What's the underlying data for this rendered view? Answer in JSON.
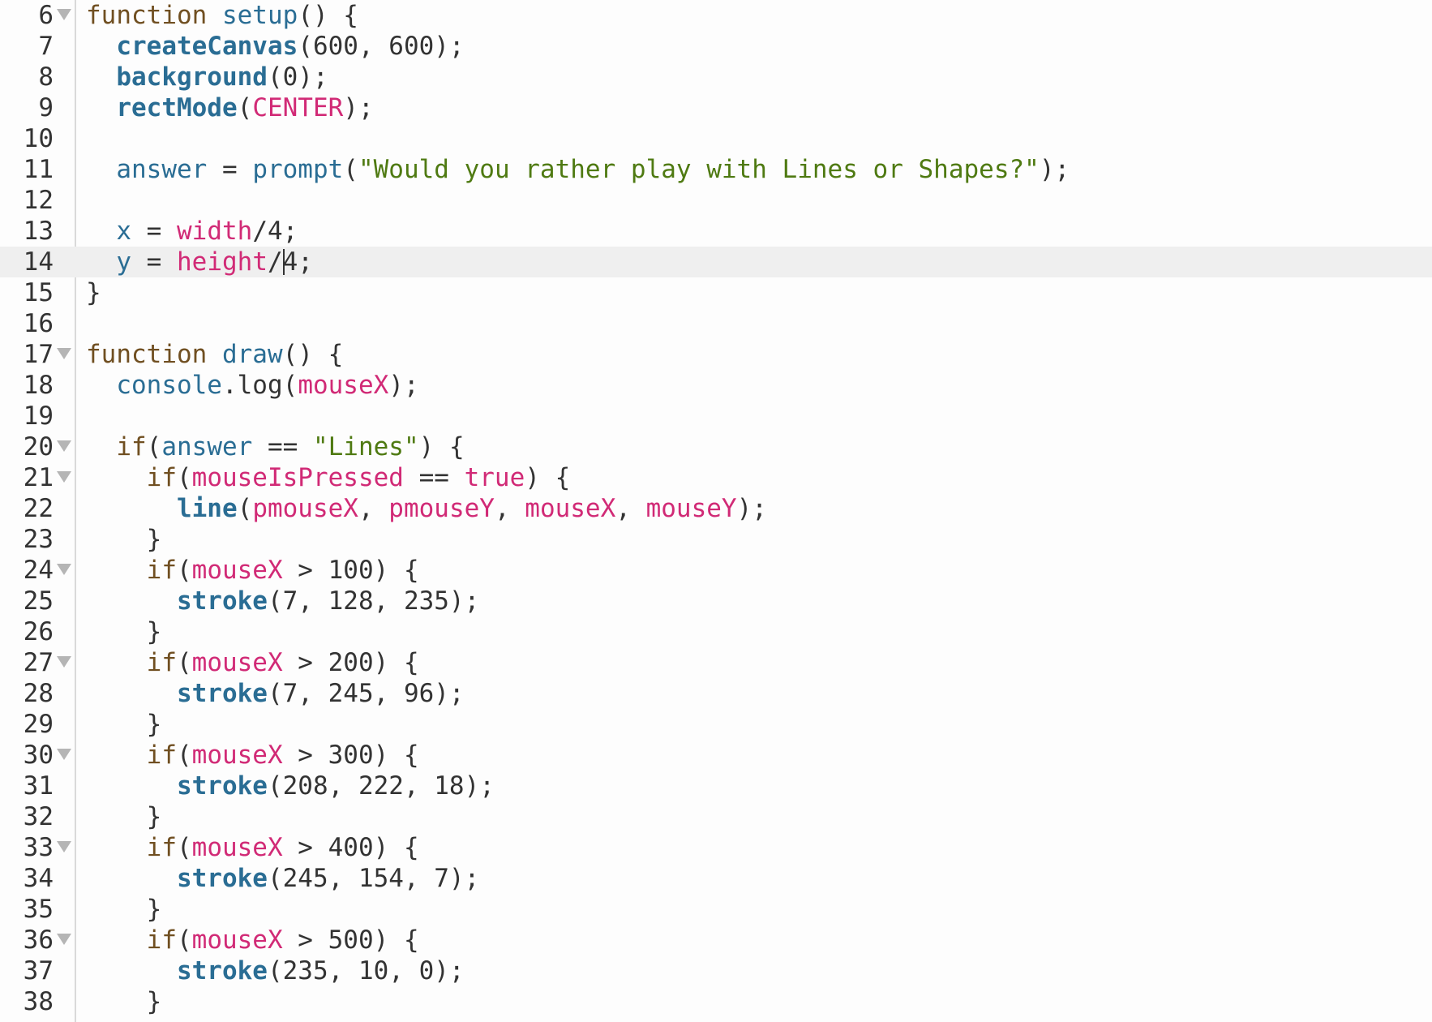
{
  "editor": {
    "active_line_number": "14",
    "lines": [
      {
        "num": "6",
        "fold": true,
        "active": false,
        "tokens": [
          [
            "kw",
            "function"
          ],
          [
            "pl",
            " "
          ],
          [
            "fn",
            "setup"
          ],
          [
            "pl",
            "() {"
          ]
        ]
      },
      {
        "num": "7",
        "fold": false,
        "active": false,
        "tokens": [
          [
            "pl",
            "  "
          ],
          [
            "bi",
            "createCanvas"
          ],
          [
            "pl",
            "(600, 600);"
          ]
        ]
      },
      {
        "num": "8",
        "fold": false,
        "active": false,
        "tokens": [
          [
            "pl",
            "  "
          ],
          [
            "bi",
            "background"
          ],
          [
            "pl",
            "(0);"
          ]
        ]
      },
      {
        "num": "9",
        "fold": false,
        "active": false,
        "tokens": [
          [
            "pl",
            "  "
          ],
          [
            "bi",
            "rectMode"
          ],
          [
            "pl",
            "("
          ],
          [
            "mg",
            "CENTER"
          ],
          [
            "pl",
            ");"
          ]
        ]
      },
      {
        "num": "10",
        "fold": false,
        "active": false,
        "tokens": []
      },
      {
        "num": "11",
        "fold": false,
        "active": false,
        "tokens": [
          [
            "pl",
            "  "
          ],
          [
            "fn",
            "answer"
          ],
          [
            "pl",
            " = "
          ],
          [
            "fn",
            "prompt"
          ],
          [
            "pl",
            "("
          ],
          [
            "st",
            "\"Would you rather play with Lines or Shapes?\""
          ],
          [
            "pl",
            ");"
          ]
        ]
      },
      {
        "num": "12",
        "fold": false,
        "active": false,
        "tokens": []
      },
      {
        "num": "13",
        "fold": false,
        "active": false,
        "tokens": [
          [
            "pl",
            "  "
          ],
          [
            "fn",
            "x"
          ],
          [
            "pl",
            " = "
          ],
          [
            "mg",
            "width"
          ],
          [
            "pl",
            "/4;"
          ]
        ]
      },
      {
        "num": "14",
        "fold": false,
        "active": true,
        "tokens": [
          [
            "pl",
            "  "
          ],
          [
            "fn",
            "y"
          ],
          [
            "pl",
            " = "
          ],
          [
            "mg",
            "height"
          ],
          [
            "pl",
            "/4;"
          ]
        ]
      },
      {
        "num": "15",
        "fold": false,
        "active": false,
        "tokens": [
          [
            "pl",
            "}"
          ]
        ]
      },
      {
        "num": "16",
        "fold": false,
        "active": false,
        "tokens": []
      },
      {
        "num": "17",
        "fold": true,
        "active": false,
        "tokens": [
          [
            "kw",
            "function"
          ],
          [
            "pl",
            " "
          ],
          [
            "fn",
            "draw"
          ],
          [
            "pl",
            "() {"
          ]
        ]
      },
      {
        "num": "18",
        "fold": false,
        "active": false,
        "tokens": [
          [
            "pl",
            "  "
          ],
          [
            "fn",
            "console"
          ],
          [
            "pl",
            ".log("
          ],
          [
            "mg",
            "mouseX"
          ],
          [
            "pl",
            ");"
          ]
        ]
      },
      {
        "num": "19",
        "fold": false,
        "active": false,
        "tokens": []
      },
      {
        "num": "20",
        "fold": true,
        "active": false,
        "tokens": [
          [
            "pl",
            "  "
          ],
          [
            "kw",
            "if"
          ],
          [
            "pl",
            "("
          ],
          [
            "fn",
            "answer"
          ],
          [
            "pl",
            " == "
          ],
          [
            "st",
            "\"Lines\""
          ],
          [
            "pl",
            ") {"
          ]
        ]
      },
      {
        "num": "21",
        "fold": true,
        "active": false,
        "tokens": [
          [
            "pl",
            "    "
          ],
          [
            "kw",
            "if"
          ],
          [
            "pl",
            "("
          ],
          [
            "mg",
            "mouseIsPressed"
          ],
          [
            "pl",
            " == "
          ],
          [
            "mg",
            "true"
          ],
          [
            "pl",
            ") {"
          ]
        ]
      },
      {
        "num": "22",
        "fold": false,
        "active": false,
        "tokens": [
          [
            "pl",
            "      "
          ],
          [
            "bi",
            "line"
          ],
          [
            "pl",
            "("
          ],
          [
            "mg",
            "pmouseX"
          ],
          [
            "pl",
            ", "
          ],
          [
            "mg",
            "pmouseY"
          ],
          [
            "pl",
            ", "
          ],
          [
            "mg",
            "mouseX"
          ],
          [
            "pl",
            ", "
          ],
          [
            "mg",
            "mouseY"
          ],
          [
            "pl",
            ");"
          ]
        ]
      },
      {
        "num": "23",
        "fold": false,
        "active": false,
        "tokens": [
          [
            "pl",
            "    }"
          ]
        ]
      },
      {
        "num": "24",
        "fold": true,
        "active": false,
        "tokens": [
          [
            "pl",
            "    "
          ],
          [
            "kw",
            "if"
          ],
          [
            "pl",
            "("
          ],
          [
            "mg",
            "mouseX"
          ],
          [
            "pl",
            " > 100) {"
          ]
        ]
      },
      {
        "num": "25",
        "fold": false,
        "active": false,
        "tokens": [
          [
            "pl",
            "      "
          ],
          [
            "bi",
            "stroke"
          ],
          [
            "pl",
            "(7, 128, 235);"
          ]
        ]
      },
      {
        "num": "26",
        "fold": false,
        "active": false,
        "tokens": [
          [
            "pl",
            "    }"
          ]
        ]
      },
      {
        "num": "27",
        "fold": true,
        "active": false,
        "tokens": [
          [
            "pl",
            "    "
          ],
          [
            "kw",
            "if"
          ],
          [
            "pl",
            "("
          ],
          [
            "mg",
            "mouseX"
          ],
          [
            "pl",
            " > 200) {"
          ]
        ]
      },
      {
        "num": "28",
        "fold": false,
        "active": false,
        "tokens": [
          [
            "pl",
            "      "
          ],
          [
            "bi",
            "stroke"
          ],
          [
            "pl",
            "(7, 245, 96);"
          ]
        ]
      },
      {
        "num": "29",
        "fold": false,
        "active": false,
        "tokens": [
          [
            "pl",
            "    }"
          ]
        ]
      },
      {
        "num": "30",
        "fold": true,
        "active": false,
        "tokens": [
          [
            "pl",
            "    "
          ],
          [
            "kw",
            "if"
          ],
          [
            "pl",
            "("
          ],
          [
            "mg",
            "mouseX"
          ],
          [
            "pl",
            " > 300) {"
          ]
        ]
      },
      {
        "num": "31",
        "fold": false,
        "active": false,
        "tokens": [
          [
            "pl",
            "      "
          ],
          [
            "bi",
            "stroke"
          ],
          [
            "pl",
            "(208, 222, 18);"
          ]
        ]
      },
      {
        "num": "32",
        "fold": false,
        "active": false,
        "tokens": [
          [
            "pl",
            "    }"
          ]
        ]
      },
      {
        "num": "33",
        "fold": true,
        "active": false,
        "tokens": [
          [
            "pl",
            "    "
          ],
          [
            "kw",
            "if"
          ],
          [
            "pl",
            "("
          ],
          [
            "mg",
            "mouseX"
          ],
          [
            "pl",
            " > 400) {"
          ]
        ]
      },
      {
        "num": "34",
        "fold": false,
        "active": false,
        "tokens": [
          [
            "pl",
            "      "
          ],
          [
            "bi",
            "stroke"
          ],
          [
            "pl",
            "(245, 154, 7);"
          ]
        ]
      },
      {
        "num": "35",
        "fold": false,
        "active": false,
        "tokens": [
          [
            "pl",
            "    }"
          ]
        ]
      },
      {
        "num": "36",
        "fold": true,
        "active": false,
        "tokens": [
          [
            "pl",
            "    "
          ],
          [
            "kw",
            "if"
          ],
          [
            "pl",
            "("
          ],
          [
            "mg",
            "mouseX"
          ],
          [
            "pl",
            " > 500) {"
          ]
        ]
      },
      {
        "num": "37",
        "fold": false,
        "active": false,
        "tokens": [
          [
            "pl",
            "      "
          ],
          [
            "bi",
            "stroke"
          ],
          [
            "pl",
            "(235, 10, 0);"
          ]
        ]
      },
      {
        "num": "38",
        "fold": false,
        "active": false,
        "tokens": [
          [
            "pl",
            "    }"
          ]
        ]
      }
    ],
    "colors": {
      "keyword": "#704f21",
      "function": "#2a6d94",
      "builtin": "#2a6d94",
      "p5_variable": "#d12a76",
      "string": "#4f7a12",
      "plain": "#333333",
      "active_line_bg": "#efefef",
      "background": "#fdfdfd"
    },
    "icons": {
      "fold": "fold-arrow-icon"
    }
  }
}
